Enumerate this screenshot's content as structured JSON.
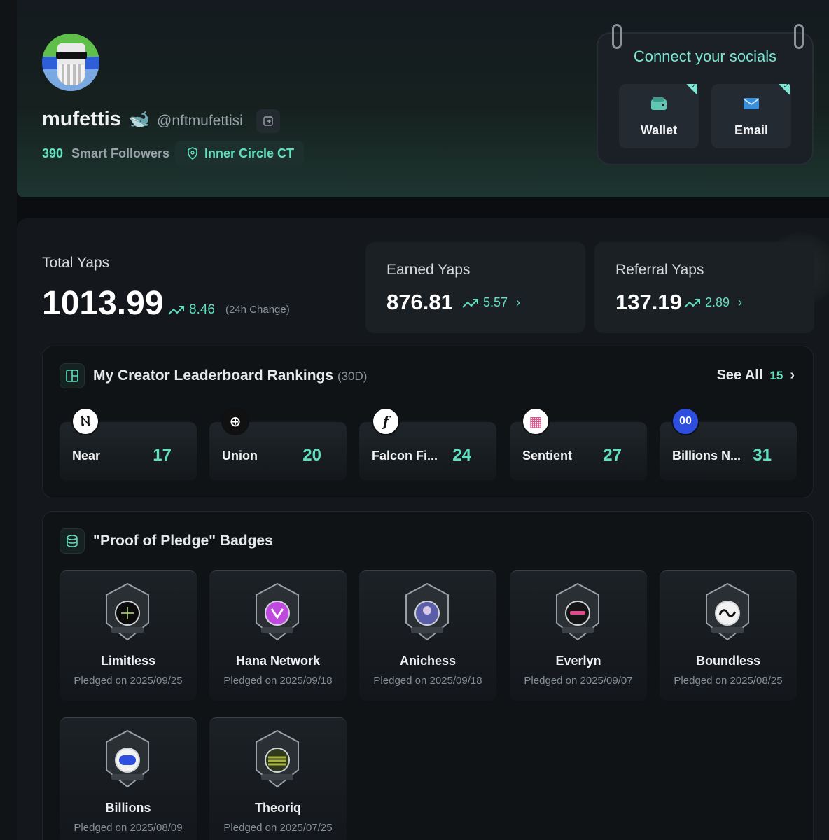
{
  "profile": {
    "username": "mufettis",
    "emoji": "🐋",
    "handle": "@nftmufettisi",
    "smart_followers_count": "390",
    "smart_followers_label": "Smart Followers",
    "badge": "Inner Circle CT"
  },
  "socials": {
    "title": "Connect your socials",
    "buttons": [
      {
        "label": "Wallet",
        "icon": "wallet-icon",
        "connected": true
      },
      {
        "label": "Email",
        "icon": "envelope-icon",
        "connected": true
      }
    ]
  },
  "yaps": {
    "total_label": "Total Yaps",
    "total_value": "1013.99",
    "total_change": "8.46",
    "total_change_note": "(24h Change)",
    "earned_label": "Earned Yaps",
    "earned_value": "876.81",
    "earned_change": "5.57",
    "referral_label": "Referral Yaps",
    "referral_value": "137.19",
    "referral_change": "2.89"
  },
  "leaderboard": {
    "title": "My Creator Leaderboard Rankings",
    "period": "(30D)",
    "see_all": "See All",
    "see_all_count": "15",
    "items": [
      {
        "name": "Near",
        "rank": "17",
        "logo": "Ⲛ"
      },
      {
        "name": "Union",
        "rank": "20",
        "logo": "⊕"
      },
      {
        "name": "Falcon Fi...",
        "rank": "24",
        "logo": "f"
      },
      {
        "name": "Sentient",
        "rank": "27",
        "logo": "▦"
      },
      {
        "name": "Billions N...",
        "rank": "31",
        "logo": "00"
      }
    ]
  },
  "pledge": {
    "title": "\"Proof of Pledge\" Badges",
    "badges": [
      {
        "name": "Limitless",
        "date": "Pledged on 2025/09/25",
        "color": "#0b0b0b"
      },
      {
        "name": "Hana Network",
        "date": "Pledged on 2025/09/18",
        "color": "#c04ae0"
      },
      {
        "name": "Anichess",
        "date": "Pledged on 2025/09/18",
        "color": "#5a5ea8"
      },
      {
        "name": "Everlyn",
        "date": "Pledged on 2025/09/07",
        "color": "#151515"
      },
      {
        "name": "Boundless",
        "date": "Pledged on 2025/08/25",
        "color": "#f2f2f2"
      },
      {
        "name": "Billions",
        "date": "Pledged on 2025/08/09",
        "color": "#2e4ee0"
      },
      {
        "name": "Theoriq",
        "date": "Pledged on 2025/07/25",
        "color": "#a9b23a"
      }
    ]
  },
  "colors": {
    "accent": "#5fe0bf",
    "background": "#0b0d10",
    "panel": "#14181c"
  }
}
